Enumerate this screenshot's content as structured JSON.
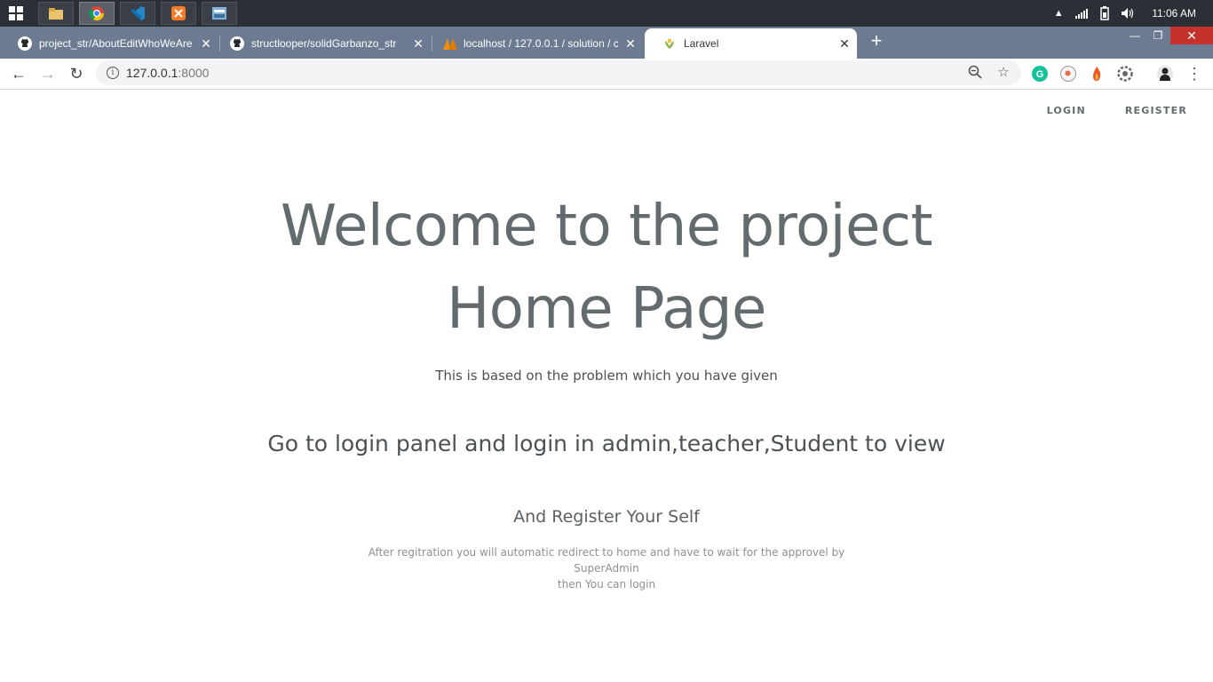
{
  "taskbar": {
    "time": "11:06 AM",
    "apps": [
      "file-explorer-icon",
      "chrome-icon",
      "vscode-icon",
      "xampp-icon",
      "app-window-icon"
    ]
  },
  "browser": {
    "tabs": [
      {
        "title": "project_str/AboutEditWhoWeAre",
        "favicon": "github-icon"
      },
      {
        "title": "structlooper/solidGarbanzo_str",
        "favicon": "github-icon"
      },
      {
        "title": "localhost / 127.0.0.1 / solution / c",
        "favicon": "phpmyadmin-icon"
      },
      {
        "title": "Laravel",
        "favicon": "laravel-icon"
      }
    ],
    "new_tab": "+",
    "url_host": "127.0.0.1",
    "url_port": ":8000"
  },
  "page": {
    "nav": {
      "login": "LOGIN",
      "register": "REGISTER"
    },
    "title_line1": "Welcome to the project",
    "title_line2": "Home Page",
    "subtitle": "This is based on the problem which you have given",
    "heading": "Go to login panel and login in admin,teacher,Student to view",
    "subheading": "And Register Your Self",
    "note_line1": "After regitration you will automatic redirect to home and have to wait for the approvel by SuperAdmin",
    "note_line2": "then You can login"
  },
  "colors": {
    "taskbar": "#2b2f36",
    "tabstrip": "#6d7b92",
    "text": "#636b6f",
    "close_button": "#c4322b"
  }
}
